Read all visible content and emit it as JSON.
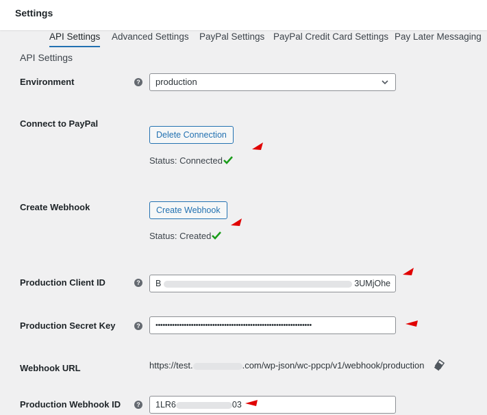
{
  "header": {
    "title": "Settings"
  },
  "tabs": [
    {
      "label": "API Settings",
      "active": true
    },
    {
      "label": "Advanced Settings"
    },
    {
      "label": "PayPal Settings"
    },
    {
      "label": "PayPal Credit Card Settings"
    },
    {
      "label": "Pay Later Messaging"
    }
  ],
  "section": {
    "title": "API Settings"
  },
  "environment": {
    "label": "Environment",
    "help": "?",
    "value": "production"
  },
  "connect": {
    "label": "Connect to PayPal",
    "button": "Delete Connection",
    "status": "Status: Connected"
  },
  "webhook": {
    "label": "Create Webhook",
    "button": "Create Webhook",
    "status": "Status: Created"
  },
  "client_id": {
    "label": "Production Client ID",
    "help": "?",
    "prefix": "B",
    "suffix": "3UMjOhe"
  },
  "secret": {
    "label": "Production Secret Key",
    "help": "?",
    "value": "••••••••••••••••••••••••••••••••••••••••••••••••••••••••••••••••••"
  },
  "webhook_url": {
    "label": "Webhook URL",
    "prefix": "https://test.",
    "suffix": ".com/wp-json/wc-ppcp/v1/webhook/production"
  },
  "webhook_id": {
    "label": "Production Webhook ID",
    "help": "?",
    "prefix": "1LR6",
    "suffix": "03"
  },
  "colors": {
    "accent": "#2271b1",
    "success": "#1a9c1a",
    "annotation": "#e00000",
    "background": "#f0f0f1"
  }
}
